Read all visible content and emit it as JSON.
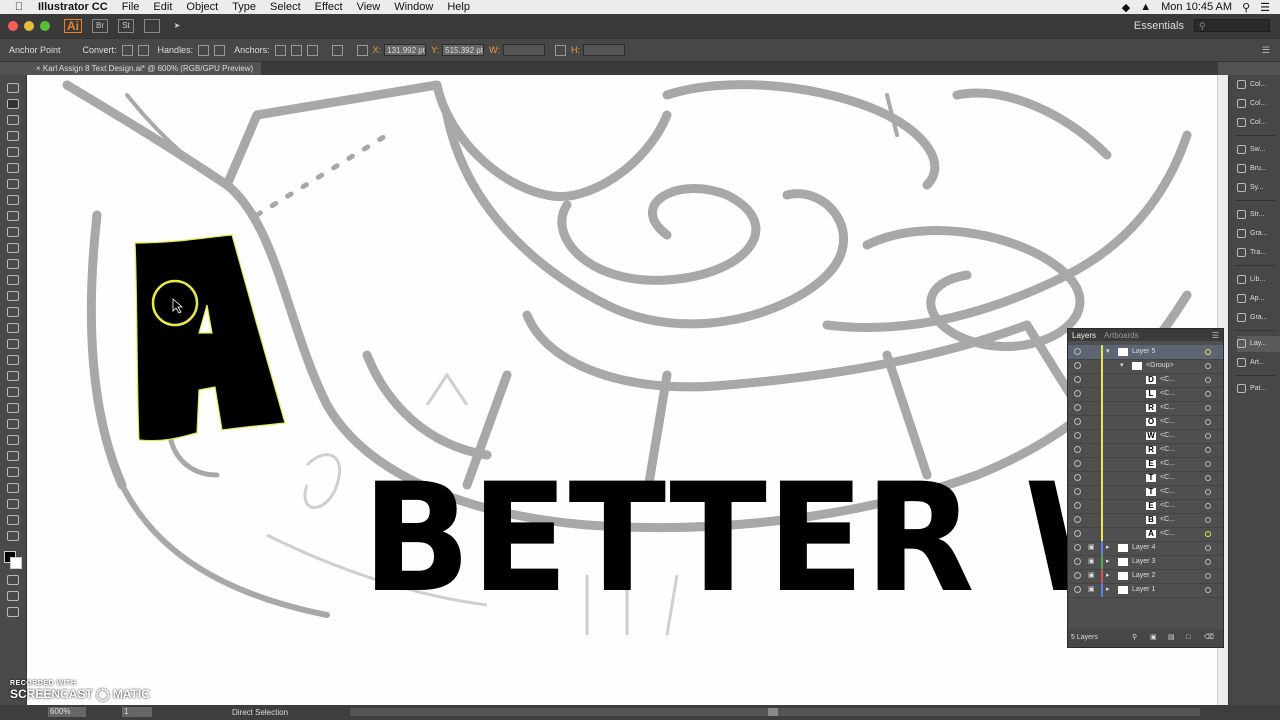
{
  "menubar": {
    "app": "Illustrator CC",
    "items": [
      "File",
      "Edit",
      "Object",
      "Type",
      "Select",
      "Effect",
      "View",
      "Window",
      "Help"
    ],
    "clock": "Mon 10:45 AM"
  },
  "apptitle": {
    "logo": "Ai",
    "btn_br": "Br",
    "btn_st": "St",
    "workspace": "Essentials",
    "search_placeholder": ""
  },
  "control": {
    "tool_name": "Anchor Point",
    "convert_label": "Convert:",
    "handles_label": "Handles:",
    "anchors_label": "Anchors:",
    "x_label": "X:",
    "x_value": "131.992 pt",
    "y_label": "Y:",
    "y_value": "515.392 pt",
    "w_label": "W:",
    "h_label": "H:"
  },
  "document": {
    "tab": "Karl Assign 8 Text Design.ai* @ 600% (RGB/GPU Preview)"
  },
  "artwork": {
    "letter_a": "A",
    "phrase": "BETTER W"
  },
  "layers": {
    "tab_layers": "Layers",
    "tab_artboards": "Artboards",
    "rows": [
      {
        "name": "Layer 5",
        "indent": "layer"
      },
      {
        "name": "<Group>",
        "indent": "group"
      },
      {
        "name": "<C...",
        "thumb": "D"
      },
      {
        "name": "<C...",
        "thumb": "L"
      },
      {
        "name": "<C...",
        "thumb": "R"
      },
      {
        "name": "<C...",
        "thumb": "O"
      },
      {
        "name": "<C...",
        "thumb": "W"
      },
      {
        "name": "<C...",
        "thumb": "R"
      },
      {
        "name": "<C...",
        "thumb": "E"
      },
      {
        "name": "<C...",
        "thumb": "T"
      },
      {
        "name": "<C...",
        "thumb": "T"
      },
      {
        "name": "<C...",
        "thumb": "E"
      },
      {
        "name": "<C...",
        "thumb": "B"
      },
      {
        "name": "<C...",
        "thumb": "A"
      },
      {
        "name": "Layer 4",
        "indent": "layer"
      },
      {
        "name": "Layer 3",
        "indent": "layer"
      },
      {
        "name": "Layer 2",
        "indent": "layer"
      },
      {
        "name": "Layer 1",
        "indent": "layer"
      }
    ],
    "footer": "5 Layers"
  },
  "dock": [
    "Col...",
    "Col...",
    "Col...",
    "Sw...",
    "Bru...",
    "Sy...",
    "Str...",
    "Gra...",
    "Tra...",
    "Lib...",
    "Ap...",
    "Gra...",
    "Lay...",
    "Art...",
    "Pat..."
  ],
  "status": {
    "zoom": "600%",
    "page": "1",
    "tool": "Direct Selection"
  },
  "watermark": {
    "line1": "RECORDED WITH",
    "line2": "SCREENCAST",
    "line3": "MATIC"
  },
  "colors": {
    "selection": "#e8e84a",
    "sketch_gray": "#a8a8a8",
    "ui_dark": "#474747"
  }
}
